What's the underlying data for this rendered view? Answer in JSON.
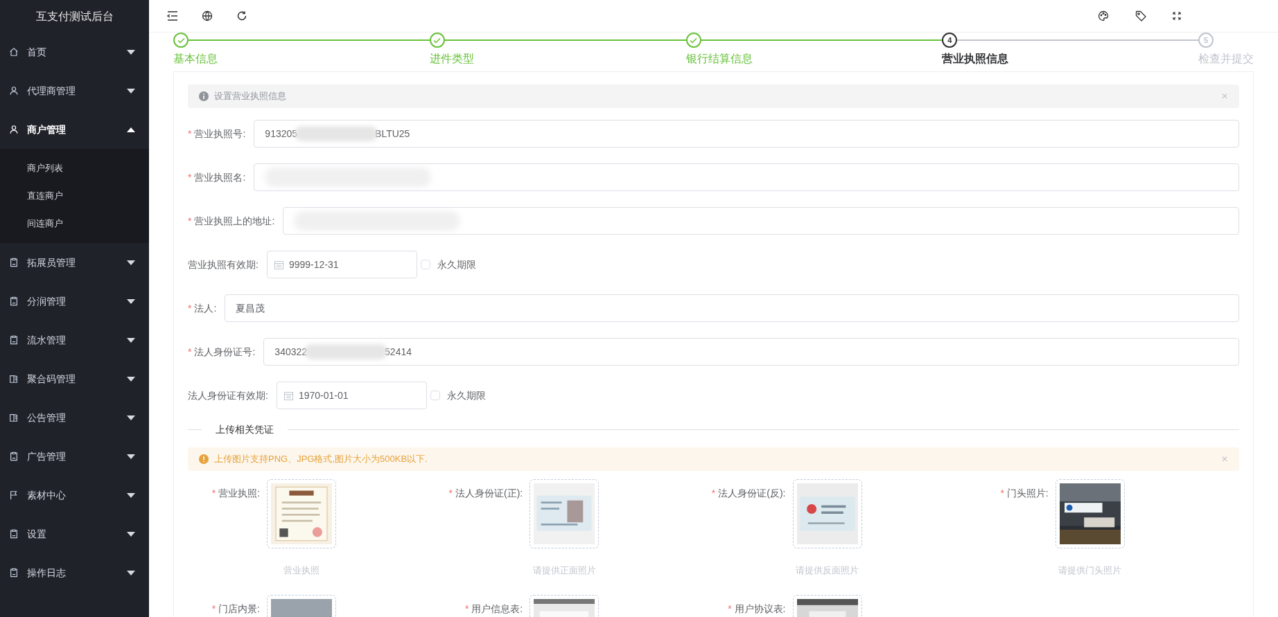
{
  "sidebar": {
    "title": "互支付测试后台",
    "items": [
      {
        "label": "首页",
        "kind": "home",
        "expanded": false,
        "selected": false
      },
      {
        "label": "代理商管理",
        "kind": "user",
        "expanded": false,
        "selected": false
      },
      {
        "label": "商户管理",
        "kind": "user",
        "expanded": true,
        "selected": true,
        "children": [
          {
            "label": "商户列表"
          },
          {
            "label": "直连商户"
          },
          {
            "label": "间连商户"
          }
        ]
      },
      {
        "label": "拓展员管理",
        "kind": "clipboard",
        "expanded": false,
        "selected": false
      },
      {
        "label": "分润管理",
        "kind": "clipboard",
        "expanded": false,
        "selected": false
      },
      {
        "label": "流水管理",
        "kind": "clipboard",
        "expanded": false,
        "selected": false
      },
      {
        "label": "聚合码管理",
        "kind": "book",
        "expanded": false,
        "selected": false
      },
      {
        "label": "公告管理",
        "kind": "book",
        "expanded": false,
        "selected": false
      },
      {
        "label": "广告管理",
        "kind": "clipboard",
        "expanded": false,
        "selected": false
      },
      {
        "label": "素材中心",
        "kind": "flag",
        "expanded": false,
        "selected": false
      },
      {
        "label": "设置",
        "kind": "clipboard",
        "expanded": false,
        "selected": false
      },
      {
        "label": "操作日志",
        "kind": "clipboard",
        "expanded": false,
        "selected": false
      }
    ]
  },
  "steps": [
    {
      "title": "基本信息",
      "completed": true,
      "selected": false
    },
    {
      "title": "进件类型",
      "completed": true,
      "selected": false
    },
    {
      "title": "银行结算信息",
      "completed": true,
      "selected": false
    },
    {
      "number": "4",
      "title": "营业执照信息",
      "completed": false,
      "selected": true
    },
    {
      "number": "5",
      "title": "检查并提交",
      "completed": false,
      "selected": false
    }
  ],
  "info_alert": {
    "text": "设置营业执照信息",
    "close": "✕"
  },
  "fields": [
    {
      "kind": "text",
      "required_mark": "*",
      "label": "营业执照号:",
      "value_start": "913205",
      "value_end": "BLTU25",
      "redacted": true
    },
    {
      "kind": "text",
      "required_mark": "*",
      "label": "营业执照名:",
      "redacted": true
    },
    {
      "kind": "text",
      "required_mark": "*",
      "label": "营业执照上的地址:",
      "redacted": true
    },
    {
      "kind": "date",
      "label": "营业执照有效期:",
      "value": "9999-12-31",
      "checkbox": {
        "label": "永久期限",
        "checked": false
      }
    },
    {
      "kind": "text",
      "required_mark": "*",
      "label": "法人:",
      "value_start": "夏昌茂"
    },
    {
      "kind": "text",
      "required_mark": "*",
      "label": "法人身份证号:",
      "value_start": "340322",
      "value_end": "52414",
      "redacted": true
    },
    {
      "kind": "date",
      "label": "法人身份证有效期:",
      "value": "1970-01-01",
      "checkbox": {
        "label": "永久期限",
        "checked": false
      }
    }
  ],
  "divider": {
    "text": "上传相关凭证"
  },
  "warning_alert": {
    "text": "上传图片支持PNG、JPG格式,图片大小为500KB以下.",
    "close": "✕"
  },
  "uploads": [
    {
      "required_mark": "*",
      "label": "营业执照:",
      "caption": "营业执照",
      "kind": "picture"
    },
    {
      "required_mark": "*",
      "label": "法人身份证(正):",
      "caption": "请提供正面照片",
      "kind": "picture"
    },
    {
      "required_mark": "*",
      "label": "法人身份证(反):",
      "caption": "请提供反面照片",
      "kind": "picture"
    },
    {
      "required_mark": "*",
      "label": "门头照片:",
      "caption": "请提供门头照片",
      "kind": "picture"
    },
    {
      "required_mark": "*",
      "label": "门店内景:",
      "kind": "picture"
    },
    {
      "required_mark": "*",
      "label": "用户信息表:",
      "kind": "picture"
    },
    {
      "required_mark": "*",
      "label": "用户协议表:",
      "kind": "picture"
    }
  ]
}
